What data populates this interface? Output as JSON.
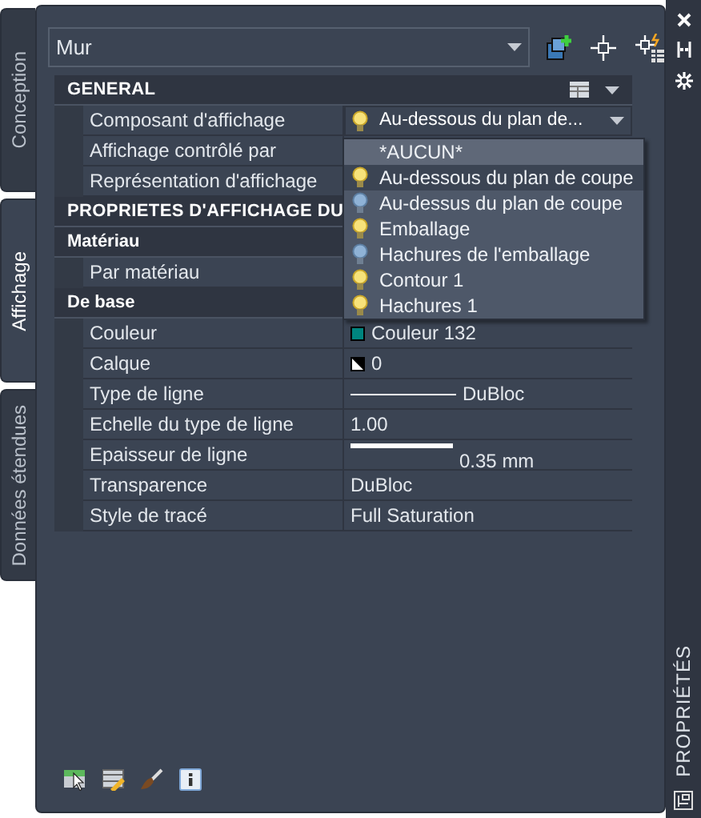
{
  "object_select": {
    "value": "Mur"
  },
  "side_tabs": [
    {
      "label": "Conception",
      "selected": false
    },
    {
      "label": "Affichage",
      "selected": true
    },
    {
      "label": "Données étendues",
      "selected": false
    }
  ],
  "palette_title": "PROPRIÉTÉS",
  "sections": [
    {
      "title": "GENERAL",
      "kind": "category",
      "rows": [
        {
          "label": "Composant d'affichage",
          "kind": "dropdown",
          "value": "Au-dessous du plan de..."
        },
        {
          "label": "Affichage contrôlé par",
          "kind": "hidden"
        },
        {
          "label": "Représentation d'affichage",
          "kind": "hidden"
        }
      ]
    },
    {
      "title": "PROPRIETES D'AFFICHAGE DU",
      "kind": "category"
    },
    {
      "title": "Matériau",
      "kind": "subcategory",
      "rows": [
        {
          "label": "Par matériau",
          "kind": "hidden"
        }
      ]
    },
    {
      "title": "De base",
      "kind": "subcategory",
      "rows": [
        {
          "label": "Couleur",
          "kind": "color",
          "value": "Couleur 132"
        },
        {
          "label": "Calque",
          "kind": "layer",
          "value": "0"
        },
        {
          "label": "Type de ligne",
          "kind": "linetype",
          "value": "DuBloc"
        },
        {
          "label": "Echelle du type de ligne",
          "kind": "text",
          "value": "1.00"
        },
        {
          "label": "Epaisseur de ligne",
          "kind": "lineweight",
          "value": "0.35 mm"
        },
        {
          "label": "Transparence",
          "kind": "text",
          "value": "DuBloc"
        },
        {
          "label": "Style de tracé",
          "kind": "text",
          "value": "Full Saturation"
        }
      ]
    }
  ],
  "dropdown_list": {
    "items": [
      {
        "label": "*AUCUN*",
        "kind": "none",
        "selected": false,
        "hovered": true
      },
      {
        "label": "Au-dessous du plan de coupe",
        "kind": "component",
        "lamp_on": true,
        "selected": true,
        "hovered": false
      },
      {
        "label": "Au-dessus du plan de coupe",
        "kind": "component",
        "lamp_on": false,
        "selected": false,
        "hovered": false
      },
      {
        "label": "Emballage",
        "kind": "component",
        "lamp_on": true,
        "selected": false,
        "hovered": false
      },
      {
        "label": "Hachures de l'emballage",
        "kind": "component",
        "lamp_on": false,
        "selected": false,
        "hovered": false
      },
      {
        "label": "Contour 1",
        "kind": "component",
        "lamp_on": true,
        "selected": false,
        "hovered": false
      },
      {
        "label": "Hachures 1",
        "kind": "component",
        "lamp_on": true,
        "selected": false,
        "hovered": false
      }
    ]
  }
}
